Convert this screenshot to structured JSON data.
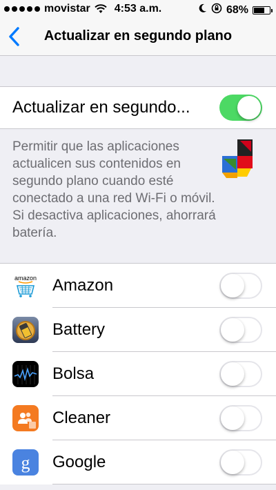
{
  "status_bar": {
    "carrier": "movistar",
    "time": "4:53 a.m.",
    "battery": "68%",
    "battery_level": 0.68
  },
  "nav": {
    "title": "Actualizar en segundo plano"
  },
  "main_setting": {
    "label": "Actualizar en segundo...",
    "enabled": true
  },
  "description": {
    "text": "Permitir que las aplicaciones actualicen sus contenidos en segundo plano cuando esté conectado a una red Wi-Fi o móvil. Si desactiva aplicaciones, ahorrará batería."
  },
  "apps": [
    {
      "name": "Amazon",
      "icon": "amazon-icon",
      "enabled": false
    },
    {
      "name": "Battery",
      "icon": "battery-icon",
      "enabled": false
    },
    {
      "name": "Bolsa",
      "icon": "stocks-icon",
      "enabled": false
    },
    {
      "name": "Cleaner",
      "icon": "cleaner-icon",
      "enabled": false
    },
    {
      "name": "Google",
      "icon": "google-icon",
      "enabled": false
    }
  ],
  "colors": {
    "accent": "#007aff",
    "toggle_on": "#4cd964",
    "background": "#efeff4"
  }
}
